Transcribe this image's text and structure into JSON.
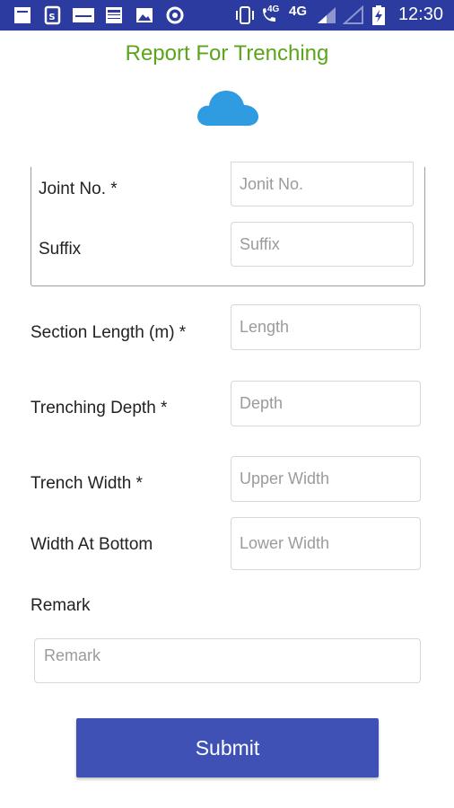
{
  "status_bar": {
    "network_small": "4G",
    "network": "4G",
    "time": "12:30",
    "background": "#2b3b9f",
    "icons": [
      "notification-square-icon",
      "notification-doc-icon",
      "notification-keyboard-icon",
      "notification-app-icon",
      "gallery-icon",
      "circle-status-icon",
      "vibrate-icon",
      "wifi-call-icon",
      "signal-icon",
      "signal-weak-icon",
      "battery-charging-icon"
    ]
  },
  "header": {
    "title": "Report For Trenching",
    "title_color": "#5aa51a",
    "icon": "cloud-icon",
    "icon_color": "#2f9be0"
  },
  "form": {
    "joint_no": {
      "label": "Joint No. *",
      "placeholder": "Jonit No.",
      "value": ""
    },
    "suffix": {
      "label": "Suffix",
      "placeholder": "Suffix",
      "value": ""
    },
    "section_length": {
      "label": "Section Length (m) *",
      "placeholder": "Length",
      "value": ""
    },
    "trenching_depth": {
      "label": "Trenching Depth *",
      "placeholder": "Depth",
      "value": ""
    },
    "trench_width": {
      "label": "Trench Width *",
      "placeholder": "Upper Width",
      "value": ""
    },
    "width_at_bottom": {
      "label": "Width At Bottom",
      "placeholder": "Lower Width",
      "value": ""
    },
    "remark": {
      "label": "Remark",
      "placeholder": "Remark",
      "value": ""
    }
  },
  "submit": {
    "label": "Submit",
    "color": "#3f51b5"
  }
}
